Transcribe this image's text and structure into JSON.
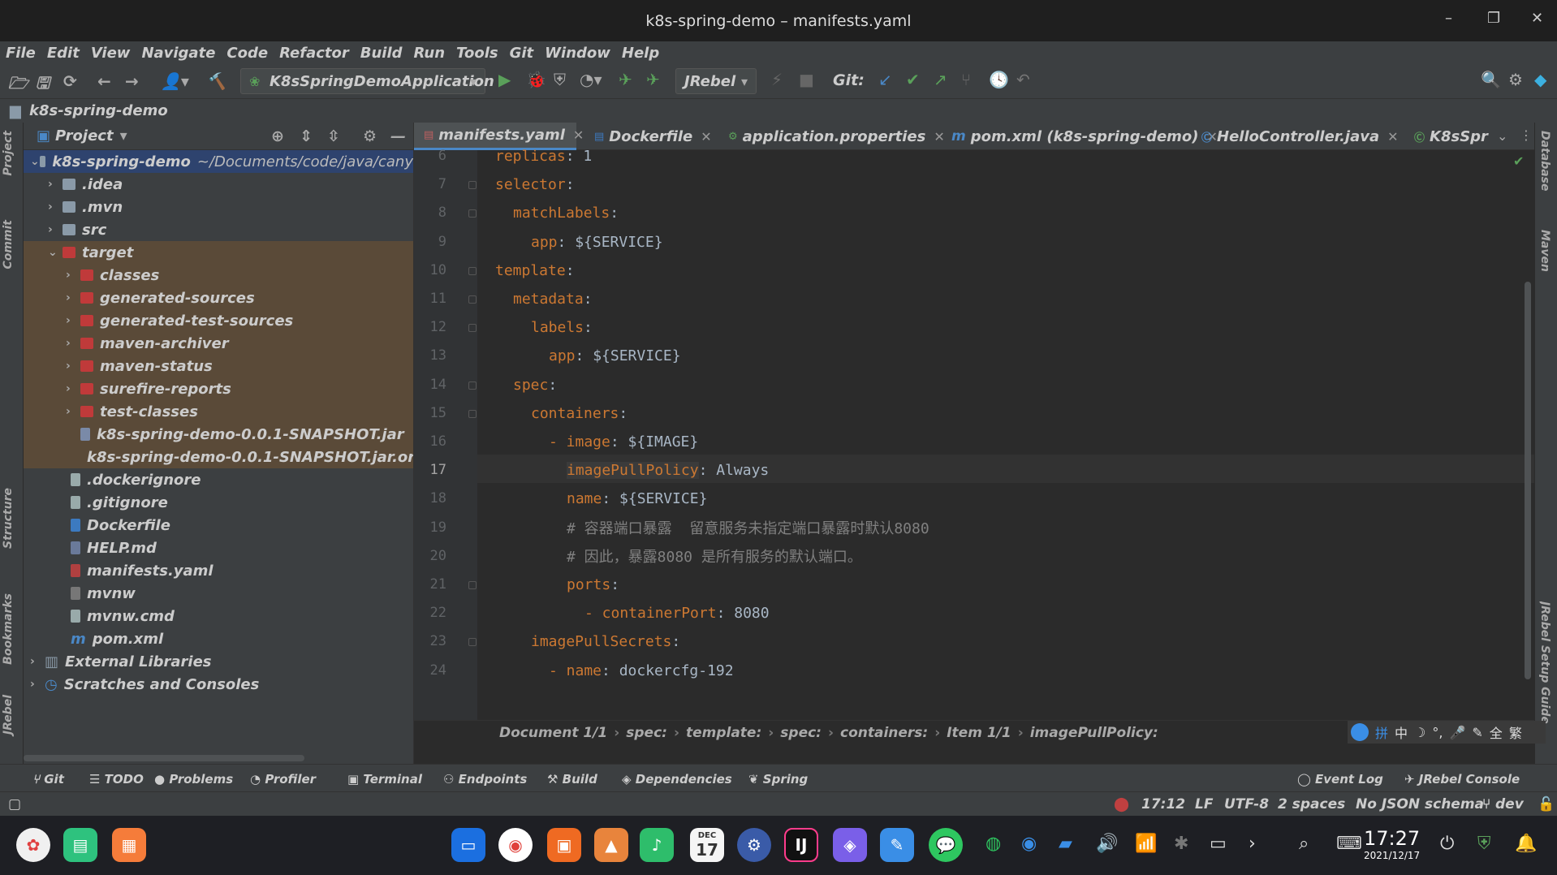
{
  "window": {
    "title": "k8s-spring-demo – manifests.yaml",
    "minimize": "–",
    "restore": "❐",
    "close": "✕"
  },
  "menu": [
    "File",
    "Edit",
    "View",
    "Navigate",
    "Code",
    "Refactor",
    "Build",
    "Run",
    "Tools",
    "Git",
    "Window",
    "Help"
  ],
  "toolbar": {
    "run_config": "K8sSpringDemoApplication",
    "jrebel": "JRebel",
    "git_label": "Git:"
  },
  "navbar": {
    "project": "k8s-spring-demo"
  },
  "side_tabs_left": [
    "Project",
    "Commit",
    "Structure",
    "Bookmarks",
    "JRebel"
  ],
  "side_tabs_right": [
    "Database",
    "Maven",
    "JRebel Setup Guide"
  ],
  "project_panel": {
    "title": "Project",
    "rows": [
      {
        "label": "k8s-spring-demo",
        "sub": "~/Documents/code/java/cany"
      },
      {
        "label": ".idea"
      },
      {
        "label": ".mvn"
      },
      {
        "label": "src"
      },
      {
        "label": "target"
      },
      {
        "label": "classes"
      },
      {
        "label": "generated-sources"
      },
      {
        "label": "generated-test-sources"
      },
      {
        "label": "maven-archiver"
      },
      {
        "label": "maven-status"
      },
      {
        "label": "surefire-reports"
      },
      {
        "label": "test-classes"
      },
      {
        "label": "k8s-spring-demo-0.0.1-SNAPSHOT.jar"
      },
      {
        "label": "k8s-spring-demo-0.0.1-SNAPSHOT.jar.ori"
      },
      {
        "label": ".dockerignore"
      },
      {
        "label": ".gitignore"
      },
      {
        "label": "Dockerfile"
      },
      {
        "label": "HELP.md"
      },
      {
        "label": "manifests.yaml"
      },
      {
        "label": "mvnw"
      },
      {
        "label": "mvnw.cmd"
      },
      {
        "label": "pom.xml"
      },
      {
        "label": "External Libraries"
      },
      {
        "label": "Scratches and Consoles"
      }
    ]
  },
  "tabs": [
    {
      "label": "manifests.yaml",
      "icon": "yml"
    },
    {
      "label": "Dockerfile",
      "icon": "docker"
    },
    {
      "label": "application.properties",
      "icon": "properties"
    },
    {
      "label": "pom.xml (k8s-spring-demo)",
      "icon": "m"
    },
    {
      "label": "HelloController.java",
      "icon": "c"
    },
    {
      "label": "K8sSpr",
      "icon": "spring"
    }
  ],
  "code": {
    "line_numbers": [
      "6",
      "7",
      "8",
      "9",
      "10",
      "11",
      "12",
      "13",
      "14",
      "15",
      "16",
      "17",
      "18",
      "19",
      "20",
      "21",
      "22",
      "23",
      "24"
    ],
    "lines": [
      {
        "key": "replicas",
        "val": ": 1"
      },
      {
        "key": "selector",
        "val": ":"
      },
      {
        "key": "matchLabels",
        "val": ":"
      },
      {
        "key": "app",
        "val": ": ${SERVICE}"
      },
      {
        "key": "template",
        "val": ":"
      },
      {
        "key": "metadata",
        "val": ":"
      },
      {
        "key": "labels",
        "val": ":"
      },
      {
        "key": "app",
        "val": ": ${SERVICE}"
      },
      {
        "key": "spec",
        "val": ":"
      },
      {
        "key": "containers",
        "val": ":"
      },
      {
        "key": "- image",
        "val": ": ${IMAGE}"
      },
      {
        "key": "imagePullPolicy",
        "val": ": Always"
      },
      {
        "key": "name",
        "val": ": ${SERVICE}"
      },
      {
        "comment": "# 容器端口暴露  留意服务未指定端口暴露时默认8080"
      },
      {
        "comment": "# 因此，暴露8080 是所有服务的默认端口。"
      },
      {
        "key": "ports",
        "val": ":"
      },
      {
        "key": "- containerPort",
        "val": ": 8080"
      },
      {
        "key": "imagePullSecrets",
        "val": ":"
      },
      {
        "key": "- name",
        "val": ": dockercfg-192"
      }
    ]
  },
  "breadcrumb": [
    "Document 1/1",
    "spec:",
    "template:",
    "spec:",
    "containers:",
    "Item 1/1",
    "imagePullPolicy:"
  ],
  "ime": [
    "拼",
    "中",
    "☽",
    "°,",
    "🎤",
    "✎",
    "全",
    "繁"
  ],
  "tool_windows": [
    "Git",
    "TODO",
    "Problems",
    "Profiler",
    "Terminal",
    "Endpoints",
    "Build",
    "Dependencies",
    "Spring",
    "Event Log",
    "JRebel Console"
  ],
  "status": {
    "position": "17:12",
    "line_sep": "LF",
    "encoding": "UTF-8",
    "indent": "2 spaces",
    "schema": "No JSON schema",
    "branch": "dev"
  },
  "clock": {
    "time": "17:27",
    "date": "2021/12/17"
  },
  "calendar_icon": {
    "month": "DEC",
    "day": "17"
  }
}
